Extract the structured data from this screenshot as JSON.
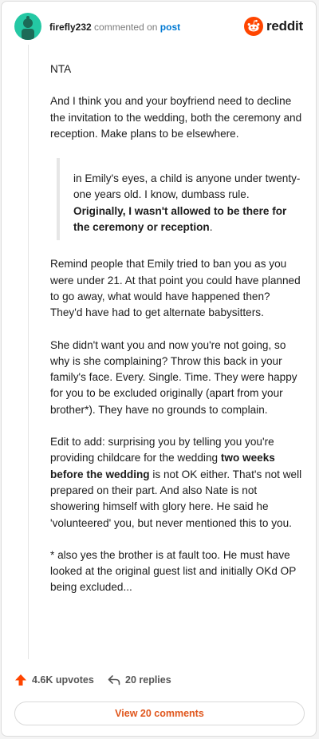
{
  "header": {
    "username": "firefly232",
    "action": "commented on",
    "target": "post",
    "logo_text": "reddit"
  },
  "comment": {
    "p1": "NTA",
    "p2": "And I think you and your boyfriend need to decline the invitation to the wedding, both the ceremony and reception. Make plans to be elsewhere.",
    "quote_plain": "in Emily's eyes, a child is anyone under twenty-one years old. I know, dumbass rule. ",
    "quote_bold": "Originally, I wasn't allowed to be there for the ceremony or reception",
    "quote_end": ".",
    "p3": "Remind people that Emily tried to ban you as you were under 21. At that point you could have planned to go away, what would have happened then? They'd have had to get alternate babysitters.",
    "p4": "She didn't want you and now you're not going, so why is she complaining? Throw this back in your family's face. Every. Single. Time. They were happy for you to be excluded originally (apart from your brother*). They have no grounds to complain.",
    "p5_a": "Edit to add: surprising you by telling you you're providing childcare for the wedding ",
    "p5_bold": "two weeks before the wedding",
    "p5_b": " is not OK either. That's not well prepared on their part. And also Nate is not showering himself with glory here. He said he 'volunteered' you, but never mentioned this to you.",
    "p6": "* also yes the brother is at fault too. He must have looked at the original guest list and initially OKd OP being excluded..."
  },
  "footer": {
    "upvotes": "4.6K upvotes",
    "replies": "20 replies",
    "view_button": "View 20 comments"
  },
  "colors": {
    "avatar": "#24c8a4",
    "reddit_orange": "#ff4500",
    "link_blue": "#0079d3",
    "view_button_text": "#e0561c"
  }
}
